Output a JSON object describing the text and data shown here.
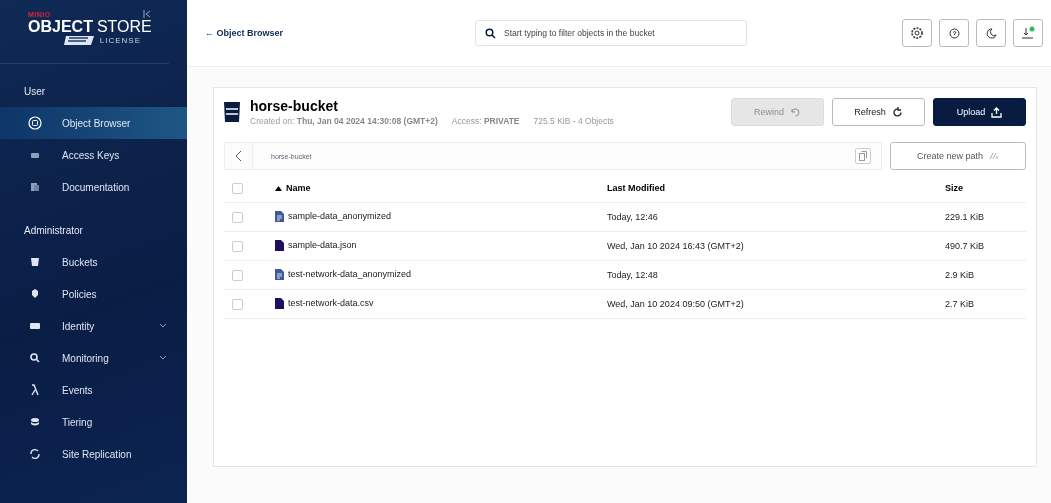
{
  "sidebar": {
    "brand": {
      "maker": "MINIO",
      "product_bold": "OBJECT",
      "product_light": "STORE",
      "license": "LICENSE"
    },
    "sections": [
      {
        "title": "User",
        "items": [
          {
            "label": "Object Browser",
            "selected": true,
            "expandable": false
          },
          {
            "label": "Access Keys",
            "selected": false,
            "expandable": false
          },
          {
            "label": "Documentation",
            "selected": false,
            "expandable": false
          }
        ]
      },
      {
        "title": "Administrator",
        "items": [
          {
            "label": "Buckets",
            "selected": false,
            "expandable": false
          },
          {
            "label": "Policies",
            "selected": false,
            "expandable": false
          },
          {
            "label": "Identity",
            "selected": false,
            "expandable": true
          },
          {
            "label": "Monitoring",
            "selected": false,
            "expandable": true
          },
          {
            "label": "Events",
            "selected": false,
            "expandable": false
          },
          {
            "label": "Tiering",
            "selected": false,
            "expandable": false
          },
          {
            "label": "Site Replication",
            "selected": false,
            "expandable": false
          }
        ]
      }
    ]
  },
  "header": {
    "back": "← Object Browser",
    "search": {
      "placeholder": "Start typing to filter objects in the bucket"
    }
  },
  "bucket": {
    "name": "horse-bucket",
    "created_label": "Created on:",
    "created": "Thu, Jan 04 2024 14:30:08 (GMT+2)",
    "access_label": "Access:",
    "access": "PRIVATE",
    "summary": "725.5 KiB - 4 Objects",
    "buttons": [
      {
        "label": "Rewind",
        "kind": "rewind",
        "disabled": true
      },
      {
        "label": "Refresh",
        "kind": "refresh",
        "disabled": false
      },
      {
        "label": "Upload",
        "kind": "upload",
        "disabled": false
      }
    ]
  },
  "path": {
    "value": "horse-bucket",
    "create": "Create new path"
  },
  "table": {
    "select_all_checked": false,
    "columns": [
      "Name",
      "Last Modified",
      "Size"
    ],
    "rows": [
      {
        "name": "sample-data_anonymized",
        "kind": "derived",
        "modified": "Today, 12:46",
        "size": "229.1 KiB",
        "checked": false
      },
      {
        "name": "sample-data.json",
        "kind": "file",
        "modified": "Wed, Jan 10 2024 16:43 (GMT+2)",
        "size": "490.7 KiB",
        "checked": false
      },
      {
        "name": "test-network-data_anonymized",
        "kind": "derived",
        "modified": "Today, 12:48",
        "size": "2.9 KiB",
        "checked": false
      },
      {
        "name": "test-network-data.csv",
        "kind": "file",
        "modified": "Wed, Jan 10 2024 09:50 (GMT+2)",
        "size": "2.7 KiB",
        "checked": false
      }
    ]
  }
}
